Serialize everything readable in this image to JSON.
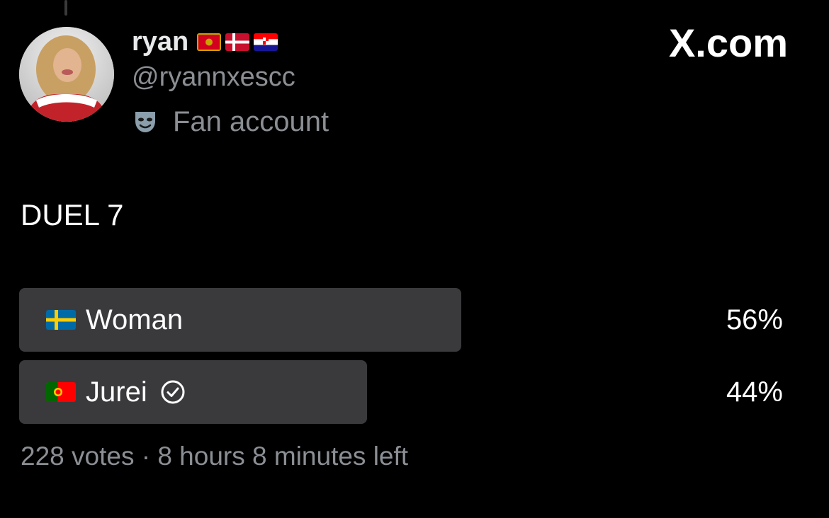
{
  "author": {
    "display_name": "ryan",
    "name_flags": [
      "flag-montenegro-icon",
      "flag-denmark-icon",
      "flag-croatia-icon"
    ],
    "handle": "@ryannxescc",
    "account_label_icon": "mask-icon",
    "account_label": "Fan account",
    "avatar_icon": "avatar-image"
  },
  "brand": {
    "text": "X.com"
  },
  "tweet": {
    "text": "DUEL 7"
  },
  "poll": {
    "options": [
      {
        "flag": "flag-sweden-icon",
        "label": "Woman",
        "percent_text": "56%",
        "share": 0.56,
        "verified": false
      },
      {
        "flag": "flag-portugal-icon",
        "label": "Jurei",
        "percent_text": "44%",
        "share": 0.44,
        "verified": true
      }
    ],
    "summary": "228 votes · 8 hours 8 minutes left",
    "bar_color": "#3a3a3d"
  },
  "colors": {
    "background": "#000000",
    "primary_text": "#e7e9ea",
    "secondary_text": "#8b8f94"
  }
}
